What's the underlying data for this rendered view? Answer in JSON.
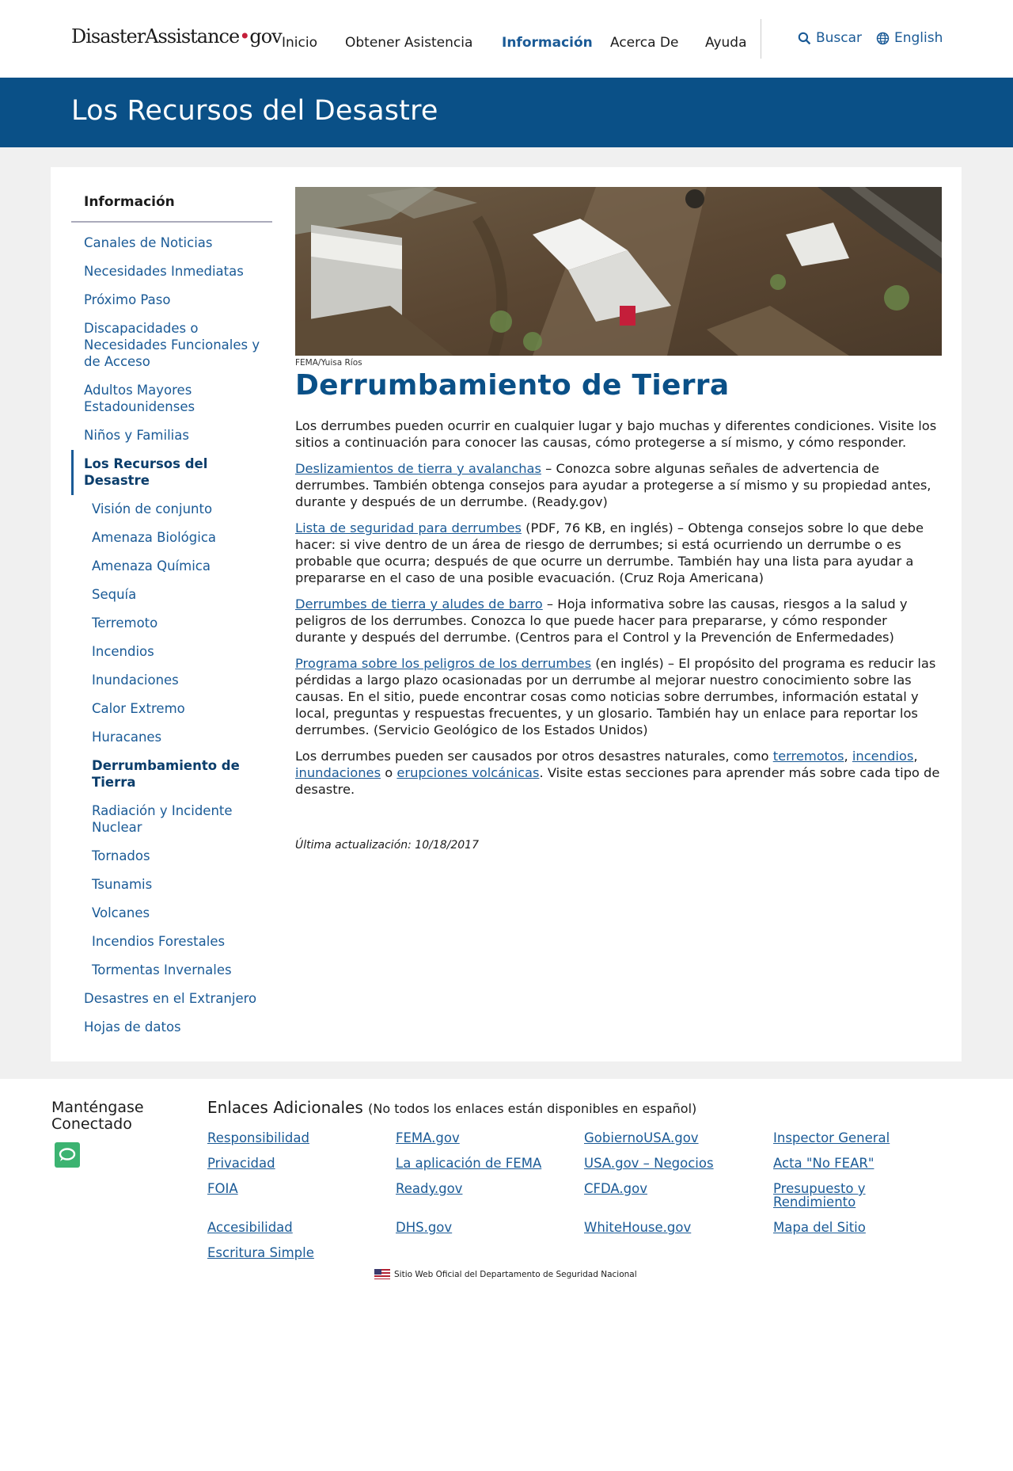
{
  "header": {
    "logo_main": "DisasterAssistance",
    "logo_suffix": "gov",
    "nav": [
      "Inicio",
      "Obtener Asistencia",
      "Información",
      "Acerca De",
      "Ayuda"
    ],
    "active_nav": "Información",
    "search_label": "Buscar",
    "language_label": "English"
  },
  "banner": {
    "title": "Los Recursos del Desastre"
  },
  "sidebar": {
    "heading": "Información",
    "items": [
      "Canales de Noticias",
      "Necesidades Inmediatas",
      "Próximo Paso",
      "Discapacidades o Necesidades Funcionales y de Acceso",
      "Adultos Mayores Estadounidenses",
      "Niños y Familias",
      "Los Recursos del Desastre",
      "Visión de conjunto",
      "Amenaza Biológica",
      "Amenaza Química",
      "Sequía",
      "Terremoto",
      "Incendios",
      "Inundaciones",
      "Calor Extremo",
      "Huracanes",
      "Derrumbamiento de Tierra",
      "Radiación y Incidente Nuclear",
      "Tornados",
      "Tsunamis",
      "Volcanes",
      "Incendios Forestales",
      "Tormentas Invernales",
      "Desastres en el Extranjero",
      "Hojas de datos"
    ]
  },
  "main": {
    "image_credit": "FEMA/Yuisa Ríos",
    "title": "Derrumbamiento de Tierra",
    "intro": "Los derrumbes pueden ocurrir en cualquier lugar y bajo muchas y diferentes condiciones. Visite los sitios a continuación para conocer las causas, cómo protegerse a sí mismo, y cómo responder.",
    "entries": [
      {
        "link": "Deslizamientos de tierra y avalanchas",
        "text": " – Conozca sobre algunas señales de advertencia de derrumbes. También obtenga consejos para ayudar a protegerse a sí mismo y su propiedad antes, durante y después de un derrumbe. (Ready.gov)"
      },
      {
        "link": "Lista de seguridad para derrumbes",
        "text": " (PDF, 76 KB, en inglés) – Obtenga consejos sobre lo que debe hacer: si vive dentro de un área de riesgo de derrumbes; si está ocurriendo un derrumbe o es probable que ocurra; después de que ocurre un derrumbe. También hay una lista para ayudar a prepararse en el caso de una posible evacuación. (Cruz Roja Americana)"
      },
      {
        "link": "Derrumbes de tierra y aludes de barro",
        "text": " – Hoja informativa sobre las causas, riesgos a la salud y peligros de los derrumbes. Conozca lo que puede hacer para prepararse, y cómo responder durante y después del derrumbe. (Centros para el Control y la Prevención de Enfermedades)"
      },
      {
        "link": "Programa sobre los peligros de los derrumbes",
        "text": " (en inglés) – El propósito del programa es reducir las pérdidas a largo plazo ocasionadas por un derrumbe al mejorar nuestro conocimiento sobre las causas. En el sitio, puede encontrar cosas como noticias sobre derrumbes, información estatal y local, preguntas y respuestas frecuentes, y un glosario. También hay un enlace para reportar los derrumbes. (Servicio Geológico de los Estados Unidos)"
      }
    ],
    "closing": {
      "prefix": "Los derrumbes pueden ser causados por otros desastres naturales, como ",
      "link1": "terremotos",
      "sep1": ", ",
      "link2": "incendios",
      "sep2": ", ",
      "link3": "inundaciones",
      "sep3": " o ",
      "link4": "erupciones volcánicas",
      "suffix": ". Visite estas secciones para aprender más sobre cada tipo de desastre."
    },
    "updated": "Última actualización: 10/18/2017"
  },
  "footer": {
    "connect_title": "Manténgase Conectado",
    "links_title": "Enlaces Adicionales",
    "links_note": "(No todos los enlaces están disponibles en español)",
    "links": [
      "Responsibilidad",
      "FEMA.gov",
      "GobiernoUSA.gov",
      "Inspector General",
      "Privacidad",
      "La aplicación de FEMA",
      "USA.gov – Negocios",
      "Acta \"No FEAR\"",
      "FOIA",
      "Ready.gov",
      "CFDA.gov",
      "Presupuesto y Rendimiento",
      "Accesibilidad",
      "DHS.gov",
      "WhiteHouse.gov",
      "Mapa del Sitio",
      "Escritura Simple"
    ],
    "official": "Sitio Web Oficial del Departamento de Seguridad Nacional"
  }
}
